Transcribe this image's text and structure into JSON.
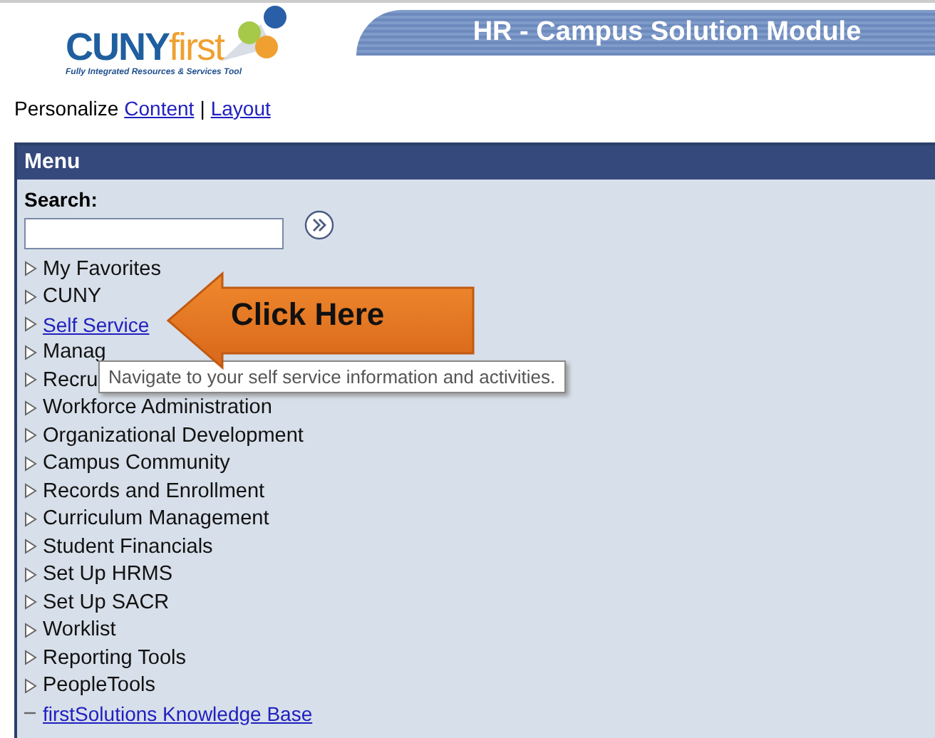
{
  "logo": {
    "brand": "CUNY",
    "brand_suffix": "first",
    "tagline": "Fully Integrated Resources & Services Tool"
  },
  "banner": {
    "title": "HR - Campus Solution Module"
  },
  "personalize": {
    "label": "Personalize",
    "links": [
      "Content",
      "Layout"
    ],
    "separator": "|"
  },
  "menu": {
    "title": "Menu",
    "search": {
      "label": "Search:"
    },
    "items": [
      {
        "kind": "folder",
        "label": "My Favorites",
        "link": false
      },
      {
        "kind": "folder",
        "label": "CUNY",
        "link": false
      },
      {
        "kind": "folder",
        "label": "Self Service",
        "link": true
      },
      {
        "kind": "folder",
        "label": "Manag",
        "link": false
      },
      {
        "kind": "folder",
        "label": "Recru",
        "link": false
      },
      {
        "kind": "folder",
        "label": "Workforce Administration",
        "link": false
      },
      {
        "kind": "folder",
        "label": "Organizational Development",
        "link": false
      },
      {
        "kind": "folder",
        "label": "Campus Community",
        "link": false
      },
      {
        "kind": "folder",
        "label": "Records and Enrollment",
        "link": false
      },
      {
        "kind": "folder",
        "label": "Curriculum Management",
        "link": false
      },
      {
        "kind": "folder",
        "label": "Student Financials",
        "link": false
      },
      {
        "kind": "folder",
        "label": "Set Up HRMS",
        "link": false
      },
      {
        "kind": "folder",
        "label": "Set Up SACR",
        "link": false
      },
      {
        "kind": "folder",
        "label": "Worklist",
        "link": false
      },
      {
        "kind": "folder",
        "label": "Reporting Tools",
        "link": false
      },
      {
        "kind": "folder",
        "label": "PeopleTools",
        "link": false
      },
      {
        "kind": "leaf",
        "label": "firstSolutions Knowledge Base",
        "link": true
      }
    ]
  },
  "tooltip": {
    "text": "Navigate to your self service information and activities."
  },
  "callout": {
    "text": "Click Here"
  }
}
